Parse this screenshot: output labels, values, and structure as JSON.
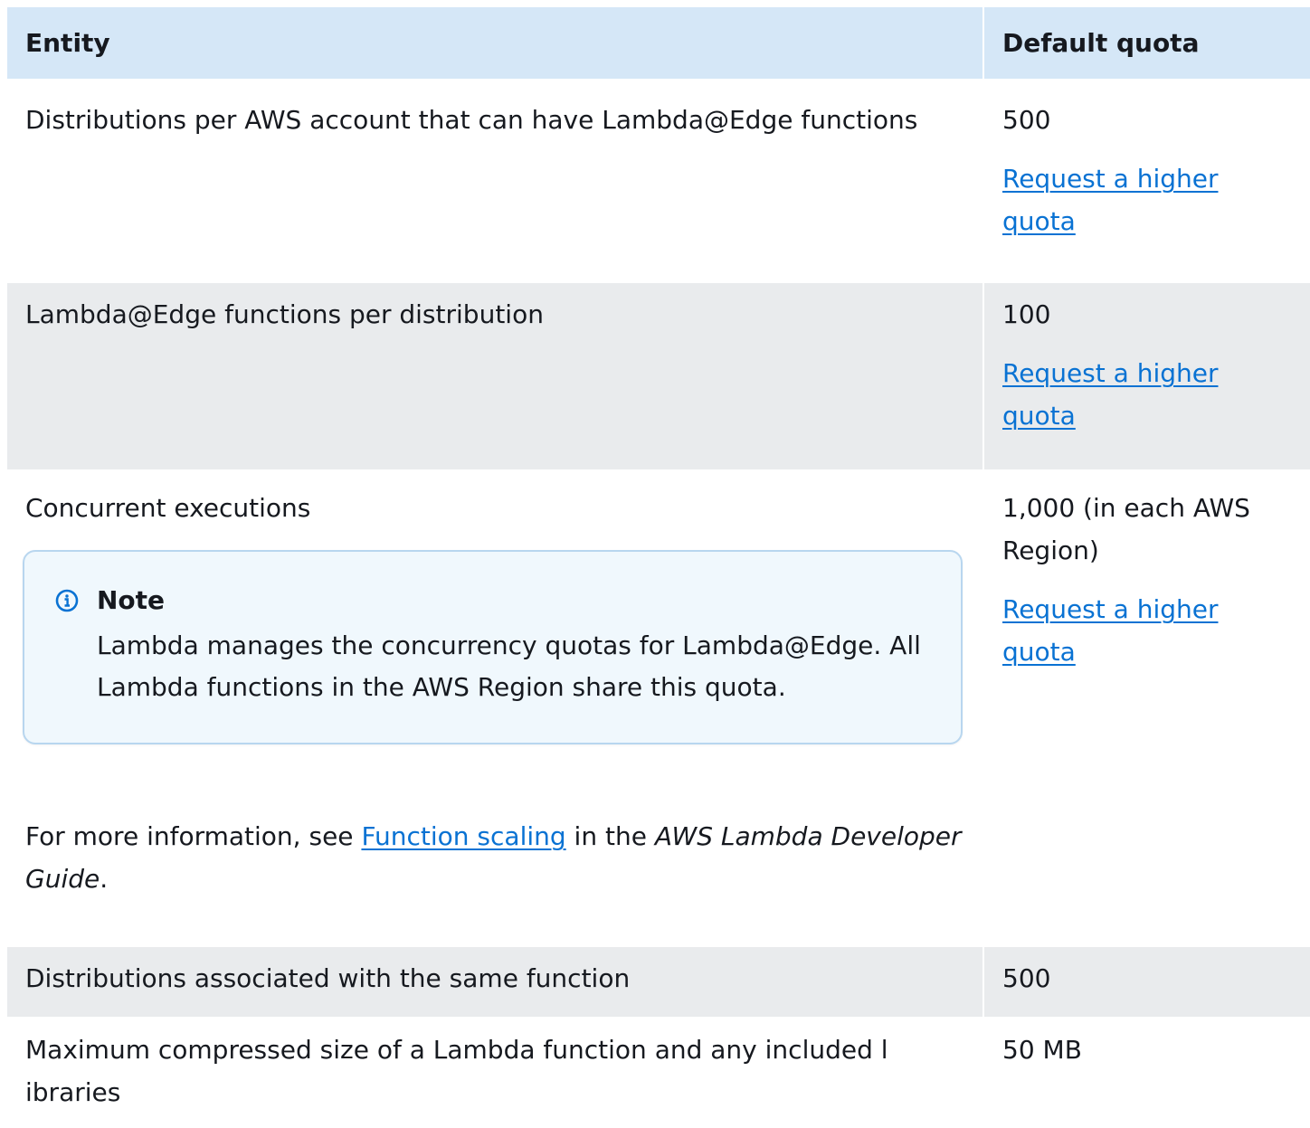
{
  "table": {
    "headers": {
      "entity": "Entity",
      "quota": "Default quota"
    },
    "rows": [
      {
        "entity": "Distributions per AWS account that can have Lambda@Edge  functions",
        "quota": "500",
        "link": "Request a higher quota"
      },
      {
        "entity": "Lambda@Edge functions per distribution",
        "quota": "100",
        "link": "Request a higher quota"
      },
      {
        "entity": "Concurrent executions",
        "quota": "1,000 (in each AWS Region)",
        "link": "Request a higher quota",
        "note": {
          "icon": "info-icon",
          "title": "Note",
          "body": "Lambda manages the concurrency quotas for Lambda@Edge. All Lambda  functions in the AWS Region share this quota."
        },
        "more_info": {
          "prefix": "For more information, see ",
          "link_text": "Function scaling",
          "middle": " in the ",
          "guide": "AWS Lambda Developer Guide",
          "suffix": "."
        }
      },
      {
        "entity": "Distributions associated with the same function",
        "quota": "500"
      },
      {
        "entity": "Maximum compressed size of a Lambda function and any included  l ibraries",
        "quota": "50 MB"
      }
    ]
  },
  "colors": {
    "header_bg": "#d5e7f7",
    "row_grey_bg": "#e9ebed",
    "link": "#0972d3",
    "note_border": "#b8d6ef",
    "note_bg": "#f0f8fd"
  }
}
